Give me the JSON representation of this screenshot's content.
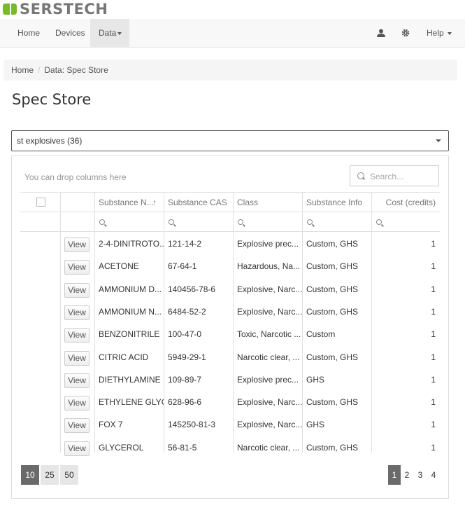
{
  "brand": {
    "name": "SERSTECH",
    "accent": "#7ab929"
  },
  "nav": {
    "home": "Home",
    "devices": "Devices",
    "data": "Data",
    "help": "Help",
    "user_icon": "user-icon",
    "settings_icon": "gear-icon"
  },
  "breadcrumb": {
    "home": "Home",
    "current": "Data: Spec Store"
  },
  "page": {
    "title": "Spec Store"
  },
  "store_select": {
    "value": "st explosives (36)"
  },
  "grid": {
    "drop_hint": "You can drop columns here",
    "search_placeholder": "Search...",
    "columns": [
      "Substance N...",
      "Substance CAS",
      "Class",
      "Substance Info",
      "Cost (credits)"
    ],
    "sort_indicator": "↑",
    "view_label": "View",
    "rows": [
      {
        "name": "2-4-DINITROTO...",
        "cas": "121-14-2",
        "class": "Explosive prec...",
        "info": "Custom, GHS",
        "cost": "1"
      },
      {
        "name": "ACETONE",
        "cas": "67-64-1",
        "class": "Hazardous, Na...",
        "info": "Custom, GHS",
        "cost": "1"
      },
      {
        "name": "AMMONIUM D...",
        "cas": "140456-78-6",
        "class": "Explosive, Narc...",
        "info": "Custom, GHS",
        "cost": "1"
      },
      {
        "name": "AMMONIUM N...",
        "cas": "6484-52-2",
        "class": "Explosive, Narc...",
        "info": "Custom, GHS",
        "cost": "1"
      },
      {
        "name": "BENZONITRILE",
        "cas": "100-47-0",
        "class": "Toxic, Narcotic ...",
        "info": "Custom",
        "cost": "1"
      },
      {
        "name": "CITRIC ACID",
        "cas": "5949-29-1",
        "class": "Narcotic clear, ...",
        "info": "Custom, GHS",
        "cost": "1"
      },
      {
        "name": "DIETHYLAMINE",
        "cas": "109-89-7",
        "class": "Explosive prec...",
        "info": "GHS",
        "cost": "1"
      },
      {
        "name": "ETHYLENE GLYC...",
        "cas": "628-96-6",
        "class": "Explosive, Narc...",
        "info": "Custom, GHS",
        "cost": "1"
      },
      {
        "name": "FOX 7",
        "cas": "145250-81-3",
        "class": "Explosive, Narc...",
        "info": "GHS",
        "cost": "1"
      },
      {
        "name": "GLYCEROL",
        "cas": "56-81-5",
        "class": "Narcotic clear, ...",
        "info": "Custom, GHS",
        "cost": "1"
      }
    ],
    "page_sizes": [
      "10",
      "25",
      "50"
    ],
    "pages": [
      "1",
      "2",
      "3",
      "4"
    ]
  }
}
